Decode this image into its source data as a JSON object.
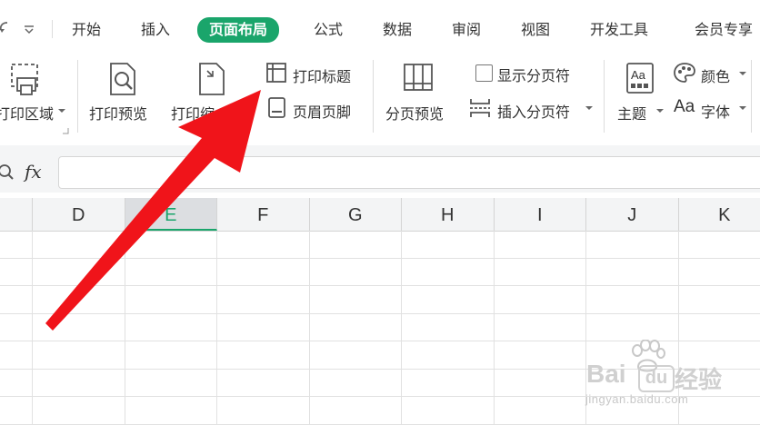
{
  "tabs": {
    "start": "开始",
    "insert": "插入",
    "page_layout": "页面布局",
    "formula": "公式",
    "data": "数据",
    "review": "审阅",
    "view": "视图",
    "dev_tools": "开发工具",
    "member": "会员专享"
  },
  "ribbon": {
    "print_area": "打印区域",
    "print_preview": "打印预览",
    "print_scale": "打印缩",
    "print_titles": "打印标题",
    "header_footer": "页眉页脚",
    "page_break_preview": "分页预览",
    "show_page_breaks": "显示分页符",
    "insert_page_break": "插入分页符",
    "theme": "主题",
    "colors": "颜色",
    "fonts": "字体",
    "fonts_prefix": "Aa"
  },
  "formula_bar": {
    "fx": "fx",
    "value": ""
  },
  "columns": [
    "D",
    "E",
    "F",
    "G",
    "H",
    "I",
    "J",
    "K"
  ],
  "selected_column": "E",
  "watermark": {
    "brand": "Bai",
    "brand2": "经验",
    "url": "jingyan.baidu.com"
  },
  "colors": {
    "accent": "#1aa56b",
    "arrow": "#f0141a"
  }
}
